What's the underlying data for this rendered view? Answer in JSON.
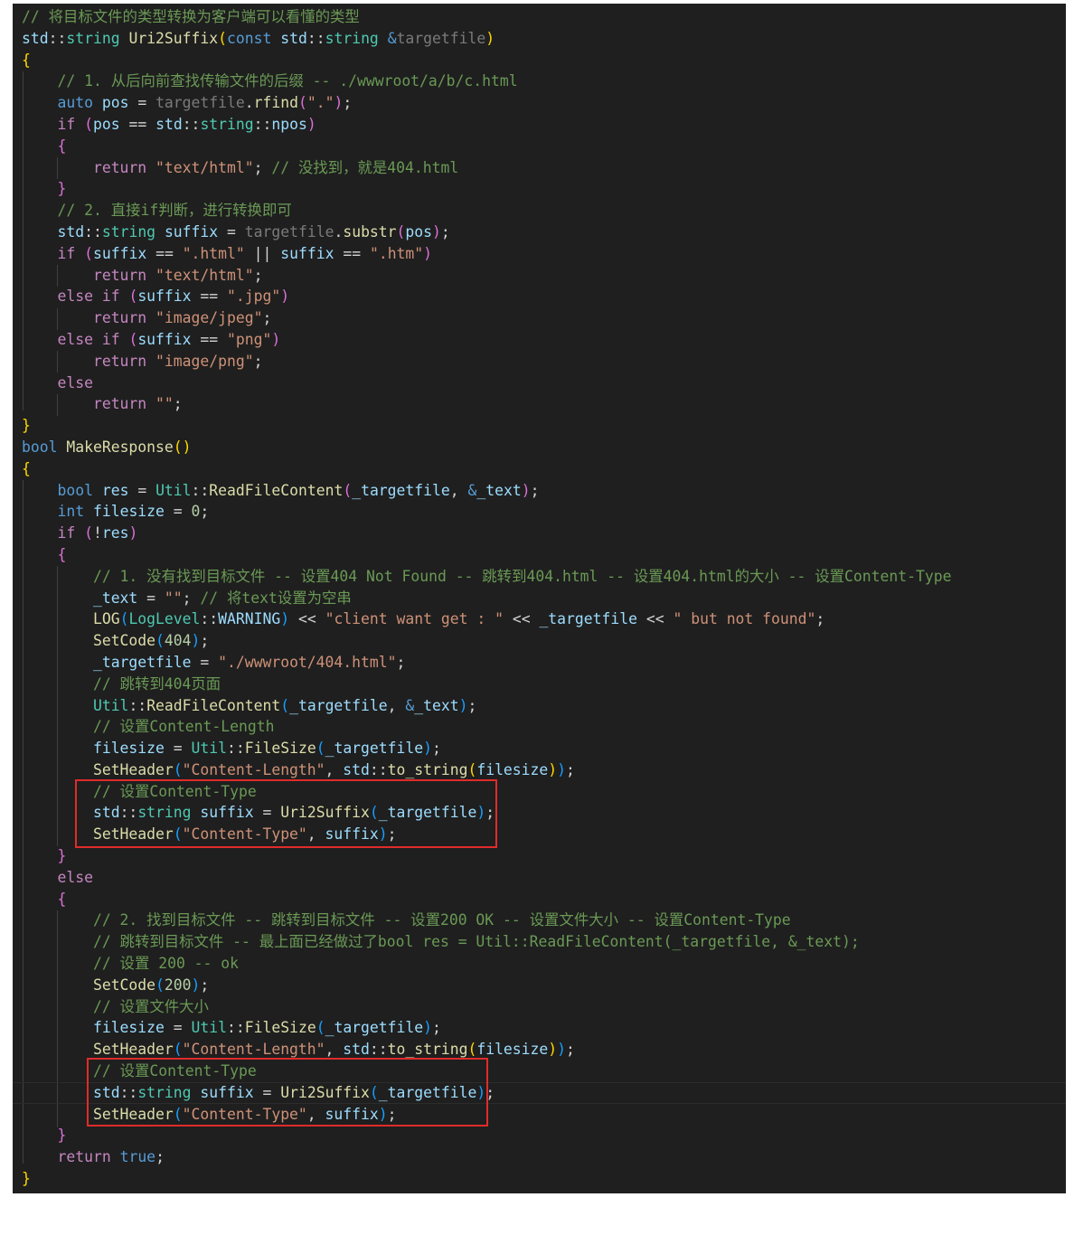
{
  "editor": {
    "language": "cpp",
    "theme": "dark",
    "colors": {
      "background": "#1f1f1f",
      "comment": "#6a9955",
      "keyword": "#569cd6",
      "type": "#4ec9b0",
      "function": "#dcdcaa",
      "string": "#ce9178",
      "number": "#b5cea8",
      "highlight_box": "#e02b2b"
    },
    "lines": [
      [
        [
          "c",
          "// 将目标文件的类型转换为客户端可以看懂的类型"
        ]
      ],
      [
        [
          "v",
          "std"
        ],
        [
          "",
          "::"
        ],
        [
          "t",
          "string"
        ],
        [
          "",
          " "
        ],
        [
          "f",
          "Uri2Suffix"
        ],
        [
          "b1",
          "("
        ],
        [
          "k",
          "const"
        ],
        [
          "",
          " "
        ],
        [
          "v",
          "std"
        ],
        [
          "",
          "::"
        ],
        [
          "t",
          "string"
        ],
        [
          "",
          " "
        ],
        [
          "k",
          "&"
        ],
        [
          "p",
          "targetfile"
        ],
        [
          "b1",
          ")"
        ]
      ],
      [
        [
          "b1",
          "{"
        ]
      ],
      [
        [
          "",
          "    "
        ],
        [
          "c",
          "// 1. 从后向前查找传输文件的后缀 -- ./wwwroot/a/b/c.html"
        ]
      ],
      [
        [
          "",
          "    "
        ],
        [
          "k",
          "auto"
        ],
        [
          "",
          " "
        ],
        [
          "v",
          "pos"
        ],
        [
          "",
          " = "
        ],
        [
          "p",
          "targetfile"
        ],
        [
          "",
          "."
        ],
        [
          "f",
          "rfind"
        ],
        [
          "b2",
          "("
        ],
        [
          "s",
          "\".\""
        ],
        [
          "b2",
          ")"
        ],
        [
          "",
          ";"
        ]
      ],
      [
        [
          "",
          "    "
        ],
        [
          "cf",
          "if"
        ],
        [
          "",
          " "
        ],
        [
          "b2",
          "("
        ],
        [
          "v",
          "pos"
        ],
        [
          "",
          " == "
        ],
        [
          "v",
          "std"
        ],
        [
          "",
          "::"
        ],
        [
          "t",
          "string"
        ],
        [
          "",
          "::"
        ],
        [
          "v",
          "npos"
        ],
        [
          "b2",
          ")"
        ]
      ],
      [
        [
          "",
          "    "
        ],
        [
          "b2",
          "{"
        ]
      ],
      [
        [
          "",
          "        "
        ],
        [
          "cf",
          "return"
        ],
        [
          "",
          " "
        ],
        [
          "s",
          "\"text/html\""
        ],
        [
          "",
          "; "
        ],
        [
          "c",
          "// 没找到，就是404.html"
        ]
      ],
      [
        [
          "",
          "    "
        ],
        [
          "b2",
          "}"
        ]
      ],
      [
        [
          "",
          "    "
        ],
        [
          "c",
          "// 2. 直接if判断，进行转换即可"
        ]
      ],
      [
        [
          "",
          "    "
        ],
        [
          "v",
          "std"
        ],
        [
          "",
          "::"
        ],
        [
          "t",
          "string"
        ],
        [
          "",
          " "
        ],
        [
          "v",
          "suffix"
        ],
        [
          "",
          " = "
        ],
        [
          "p",
          "targetfile"
        ],
        [
          "",
          "."
        ],
        [
          "f",
          "substr"
        ],
        [
          "b2",
          "("
        ],
        [
          "v",
          "pos"
        ],
        [
          "b2",
          ")"
        ],
        [
          "",
          ";"
        ]
      ],
      [
        [
          "",
          "    "
        ],
        [
          "cf",
          "if"
        ],
        [
          "",
          " "
        ],
        [
          "b2",
          "("
        ],
        [
          "v",
          "suffix"
        ],
        [
          "",
          " == "
        ],
        [
          "s",
          "\".html\""
        ],
        [
          "",
          " || "
        ],
        [
          "v",
          "suffix"
        ],
        [
          "",
          " == "
        ],
        [
          "s",
          "\".htm\""
        ],
        [
          "b2",
          ")"
        ]
      ],
      [
        [
          "",
          "        "
        ],
        [
          "cf",
          "return"
        ],
        [
          "",
          " "
        ],
        [
          "s",
          "\"text/html\""
        ],
        [
          "",
          ";"
        ]
      ],
      [
        [
          "",
          "    "
        ],
        [
          "cf",
          "else if"
        ],
        [
          "",
          " "
        ],
        [
          "b2",
          "("
        ],
        [
          "v",
          "suffix"
        ],
        [
          "",
          " == "
        ],
        [
          "s",
          "\".jpg\""
        ],
        [
          "b2",
          ")"
        ]
      ],
      [
        [
          "",
          "        "
        ],
        [
          "cf",
          "return"
        ],
        [
          "",
          " "
        ],
        [
          "s",
          "\"image/jpeg\""
        ],
        [
          "",
          ";"
        ]
      ],
      [
        [
          "",
          "    "
        ],
        [
          "cf",
          "else if"
        ],
        [
          "",
          " "
        ],
        [
          "b2",
          "("
        ],
        [
          "v",
          "suffix"
        ],
        [
          "",
          " == "
        ],
        [
          "s",
          "\"png\""
        ],
        [
          "b2",
          ")"
        ]
      ],
      [
        [
          "",
          "        "
        ],
        [
          "cf",
          "return"
        ],
        [
          "",
          " "
        ],
        [
          "s",
          "\"image/png\""
        ],
        [
          "",
          ";"
        ]
      ],
      [
        [
          "",
          "    "
        ],
        [
          "cf",
          "else"
        ]
      ],
      [
        [
          "",
          "        "
        ],
        [
          "cf",
          "return"
        ],
        [
          "",
          " "
        ],
        [
          "s",
          "\"\""
        ],
        [
          "",
          ";"
        ]
      ],
      [
        [
          "b1",
          "}"
        ]
      ],
      [
        [
          "k",
          "bool"
        ],
        [
          "",
          " "
        ],
        [
          "f",
          "MakeResponse"
        ],
        [
          "b1",
          "()"
        ]
      ],
      [
        [
          "b1",
          "{"
        ]
      ],
      [
        [
          "",
          "    "
        ],
        [
          "k",
          "bool"
        ],
        [
          "",
          " "
        ],
        [
          "v",
          "res"
        ],
        [
          "",
          " = "
        ],
        [
          "t",
          "Util"
        ],
        [
          "",
          "::"
        ],
        [
          "f",
          "ReadFileContent"
        ],
        [
          "b2",
          "("
        ],
        [
          "v",
          "_targetfile"
        ],
        [
          "",
          ", "
        ],
        [
          "k",
          "&"
        ],
        [
          "v",
          "_text"
        ],
        [
          "b2",
          ")"
        ],
        [
          "",
          ";"
        ]
      ],
      [
        [
          "",
          "    "
        ],
        [
          "k",
          "int"
        ],
        [
          "",
          " "
        ],
        [
          "v",
          "filesize"
        ],
        [
          "",
          " = "
        ],
        [
          "n",
          "0"
        ],
        [
          "",
          ";"
        ]
      ],
      [
        [
          "",
          "    "
        ],
        [
          "cf",
          "if"
        ],
        [
          "",
          " "
        ],
        [
          "b2",
          "("
        ],
        [
          "",
          "!"
        ],
        [
          "v",
          "res"
        ],
        [
          "b2",
          ")"
        ]
      ],
      [
        [
          "",
          "    "
        ],
        [
          "b2",
          "{"
        ]
      ],
      [
        [
          "",
          "        "
        ],
        [
          "c",
          "// 1. 没有找到目标文件 -- 设置404 Not Found -- 跳转到404.html -- 设置404.html的大小 -- 设置Content-Type"
        ]
      ],
      [
        [
          "",
          "        "
        ],
        [
          "v",
          "_text"
        ],
        [
          "",
          " = "
        ],
        [
          "s",
          "\"\""
        ],
        [
          "",
          "; "
        ],
        [
          "c",
          "// 将text设置为空串"
        ]
      ],
      [
        [
          "",
          "        "
        ],
        [
          "f",
          "LOG"
        ],
        [
          "b3",
          "("
        ],
        [
          "t",
          "LogLevel"
        ],
        [
          "",
          "::"
        ],
        [
          "v",
          "WARNING"
        ],
        [
          "b3",
          ")"
        ],
        [
          "",
          " << "
        ],
        [
          "s",
          "\"client want get : \""
        ],
        [
          "",
          " << "
        ],
        [
          "v",
          "_targetfile"
        ],
        [
          "",
          " << "
        ],
        [
          "s",
          "\" but not found\""
        ],
        [
          "",
          ";"
        ]
      ],
      [
        [
          "",
          "        "
        ],
        [
          "f",
          "SetCode"
        ],
        [
          "b3",
          "("
        ],
        [
          "n",
          "404"
        ],
        [
          "b3",
          ")"
        ],
        [
          "",
          ";"
        ]
      ],
      [
        [
          "",
          "        "
        ],
        [
          "v",
          "_targetfile"
        ],
        [
          "",
          " = "
        ],
        [
          "s",
          "\"./wwwroot/404.html\""
        ],
        [
          "",
          ";"
        ]
      ],
      [
        [
          "",
          "        "
        ],
        [
          "c",
          "// 跳转到404页面"
        ]
      ],
      [
        [
          "",
          "        "
        ],
        [
          "t",
          "Util"
        ],
        [
          "",
          "::"
        ],
        [
          "f",
          "ReadFileContent"
        ],
        [
          "b3",
          "("
        ],
        [
          "v",
          "_targetfile"
        ],
        [
          "",
          ", "
        ],
        [
          "k",
          "&"
        ],
        [
          "v",
          "_text"
        ],
        [
          "b3",
          ")"
        ],
        [
          "",
          ";"
        ]
      ],
      [
        [
          "",
          "        "
        ],
        [
          "c",
          "// 设置Content-Length"
        ]
      ],
      [
        [
          "",
          "        "
        ],
        [
          "v",
          "filesize"
        ],
        [
          "",
          " = "
        ],
        [
          "t",
          "Util"
        ],
        [
          "",
          "::"
        ],
        [
          "f",
          "FileSize"
        ],
        [
          "b3",
          "("
        ],
        [
          "v",
          "_targetfile"
        ],
        [
          "b3",
          ")"
        ],
        [
          "",
          ";"
        ]
      ],
      [
        [
          "",
          "        "
        ],
        [
          "f",
          "SetHeader"
        ],
        [
          "b3",
          "("
        ],
        [
          "s",
          "\"Content-Length\""
        ],
        [
          "",
          ", "
        ],
        [
          "v",
          "std"
        ],
        [
          "",
          "::"
        ],
        [
          "f",
          "to_string"
        ],
        [
          "b1",
          "("
        ],
        [
          "v",
          "filesize"
        ],
        [
          "b1",
          ")"
        ],
        [
          "b3",
          ")"
        ],
        [
          "",
          ";"
        ]
      ],
      [
        [
          "",
          "        "
        ],
        [
          "c",
          "// 设置Content-Type"
        ]
      ],
      [
        [
          "",
          "        "
        ],
        [
          "v",
          "std"
        ],
        [
          "",
          "::"
        ],
        [
          "t",
          "string"
        ],
        [
          "",
          " "
        ],
        [
          "v",
          "suffix"
        ],
        [
          "",
          " = "
        ],
        [
          "f",
          "Uri2Suffix"
        ],
        [
          "b3",
          "("
        ],
        [
          "v",
          "_targetfile"
        ],
        [
          "b3",
          ")"
        ],
        [
          "",
          ";"
        ]
      ],
      [
        [
          "",
          "        "
        ],
        [
          "f",
          "SetHeader"
        ],
        [
          "b3",
          "("
        ],
        [
          "s",
          "\"Content-Type\""
        ],
        [
          "",
          ", "
        ],
        [
          "v",
          "suffix"
        ],
        [
          "b3",
          ")"
        ],
        [
          "",
          ";"
        ]
      ],
      [
        [
          "",
          "    "
        ],
        [
          "b2",
          "}"
        ]
      ],
      [
        [
          "",
          "    "
        ],
        [
          "cf",
          "else"
        ]
      ],
      [
        [
          "",
          "    "
        ],
        [
          "b2",
          "{"
        ]
      ],
      [
        [
          "",
          "        "
        ],
        [
          "c",
          "// 2. 找到目标文件 -- 跳转到目标文件 -- 设置200 OK -- 设置文件大小 -- 设置Content-Type"
        ]
      ],
      [
        [
          "",
          "        "
        ],
        [
          "c",
          "// 跳转到目标文件 -- 最上面已经做过了bool res = Util::ReadFileContent(_targetfile, &_text);"
        ]
      ],
      [
        [
          "",
          "        "
        ],
        [
          "c",
          "// 设置 200 -- ok"
        ]
      ],
      [
        [
          "",
          "        "
        ],
        [
          "f",
          "SetCode"
        ],
        [
          "b3",
          "("
        ],
        [
          "n",
          "200"
        ],
        [
          "b3",
          ")"
        ],
        [
          "",
          ";"
        ]
      ],
      [
        [
          "",
          "        "
        ],
        [
          "c",
          "// 设置文件大小"
        ]
      ],
      [
        [
          "",
          "        "
        ],
        [
          "v",
          "filesize"
        ],
        [
          "",
          " = "
        ],
        [
          "t",
          "Util"
        ],
        [
          "",
          "::"
        ],
        [
          "f",
          "FileSize"
        ],
        [
          "b3",
          "("
        ],
        [
          "v",
          "_targetfile"
        ],
        [
          "b3",
          ")"
        ],
        [
          "",
          ";"
        ]
      ],
      [
        [
          "",
          "        "
        ],
        [
          "f",
          "SetHeader"
        ],
        [
          "b3",
          "("
        ],
        [
          "s",
          "\"Content-Length\""
        ],
        [
          "",
          ", "
        ],
        [
          "v",
          "std"
        ],
        [
          "",
          "::"
        ],
        [
          "f",
          "to_string"
        ],
        [
          "b1",
          "("
        ],
        [
          "v",
          "filesize"
        ],
        [
          "b1",
          ")"
        ],
        [
          "b3",
          ")"
        ],
        [
          "",
          ";"
        ]
      ],
      [
        [
          "",
          "        "
        ],
        [
          "c",
          "// 设置Content-Type"
        ]
      ],
      [
        [
          "",
          "        "
        ],
        [
          "v",
          "std"
        ],
        [
          "",
          "::"
        ],
        [
          "t",
          "string"
        ],
        [
          "",
          " "
        ],
        [
          "v",
          "suffix"
        ],
        [
          "",
          " = "
        ],
        [
          "f",
          "Uri2Suffix"
        ],
        [
          "b3",
          "("
        ],
        [
          "v",
          "_targetfile"
        ],
        [
          "b3",
          ")"
        ],
        [
          "",
          ";"
        ]
      ],
      [
        [
          "",
          "        "
        ],
        [
          "f",
          "SetHeader"
        ],
        [
          "b3",
          "("
        ],
        [
          "s",
          "\"Content-Type\""
        ],
        [
          "",
          ", "
        ],
        [
          "v",
          "suffix"
        ],
        [
          "b3",
          ")"
        ],
        [
          "",
          ";"
        ]
      ],
      [
        [
          "",
          "    "
        ],
        [
          "b2",
          "}"
        ]
      ],
      [
        [
          "",
          "    "
        ],
        [
          "cf",
          "return"
        ],
        [
          "",
          " "
        ],
        [
          "k",
          "true"
        ],
        [
          "",
          ";"
        ]
      ],
      [
        [
          "b1",
          "}"
        ]
      ]
    ]
  }
}
